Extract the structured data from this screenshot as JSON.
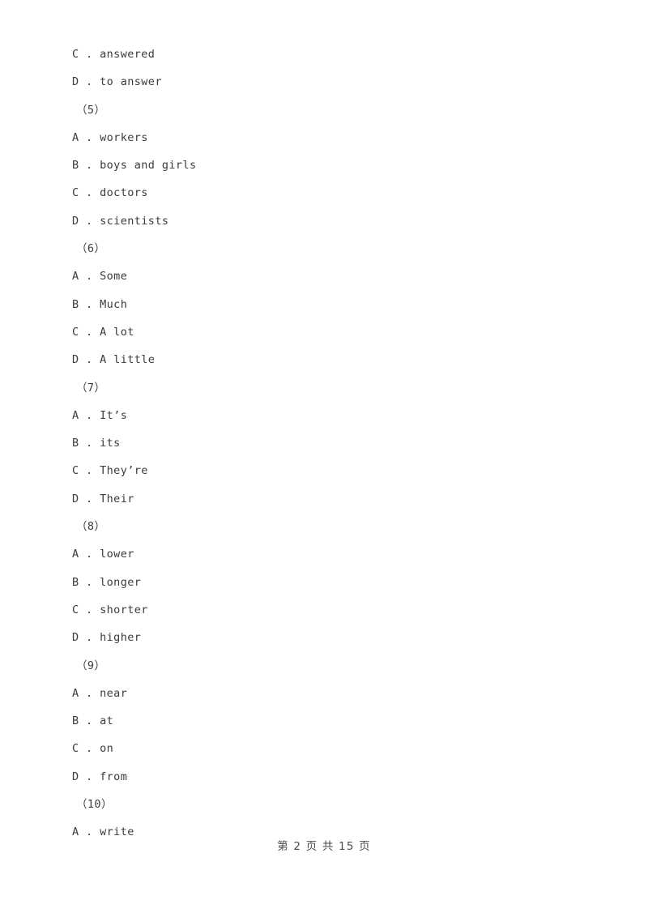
{
  "document": {
    "page_background": "#ffffff",
    "text_color": "#3b3b3b",
    "footer_color": "#4a4a4a"
  },
  "body_lines": [
    {
      "kind": "option",
      "text": "C . answered"
    },
    {
      "kind": "option",
      "text": "D . to answer"
    },
    {
      "kind": "group",
      "text": "（5）"
    },
    {
      "kind": "option",
      "text": "A . workers"
    },
    {
      "kind": "option",
      "text": "B . boys and girls"
    },
    {
      "kind": "option",
      "text": "C . doctors"
    },
    {
      "kind": "option",
      "text": "D . scientists"
    },
    {
      "kind": "group",
      "text": "（6）"
    },
    {
      "kind": "option",
      "text": "A . Some"
    },
    {
      "kind": "option",
      "text": "B . Much"
    },
    {
      "kind": "option",
      "text": "C . A lot"
    },
    {
      "kind": "option",
      "text": "D . A little"
    },
    {
      "kind": "group",
      "text": "（7）"
    },
    {
      "kind": "option",
      "text": "A . It’s"
    },
    {
      "kind": "option",
      "text": "B . its"
    },
    {
      "kind": "option",
      "text": "C . They’re"
    },
    {
      "kind": "option",
      "text": "D . Their"
    },
    {
      "kind": "group",
      "text": "（8）"
    },
    {
      "kind": "option",
      "text": "A . lower"
    },
    {
      "kind": "option",
      "text": "B . longer"
    },
    {
      "kind": "option",
      "text": "C . shorter"
    },
    {
      "kind": "option",
      "text": "D . higher"
    },
    {
      "kind": "group",
      "text": "（9）"
    },
    {
      "kind": "option",
      "text": "A . near"
    },
    {
      "kind": "option",
      "text": "B . at"
    },
    {
      "kind": "option",
      "text": "C . on"
    },
    {
      "kind": "option",
      "text": "D . from"
    },
    {
      "kind": "group",
      "text": "（10）"
    },
    {
      "kind": "option",
      "text": "A . write"
    }
  ],
  "footer": {
    "text": "第 2 页 共 15 页",
    "current_page": "2",
    "total_pages": "15"
  }
}
